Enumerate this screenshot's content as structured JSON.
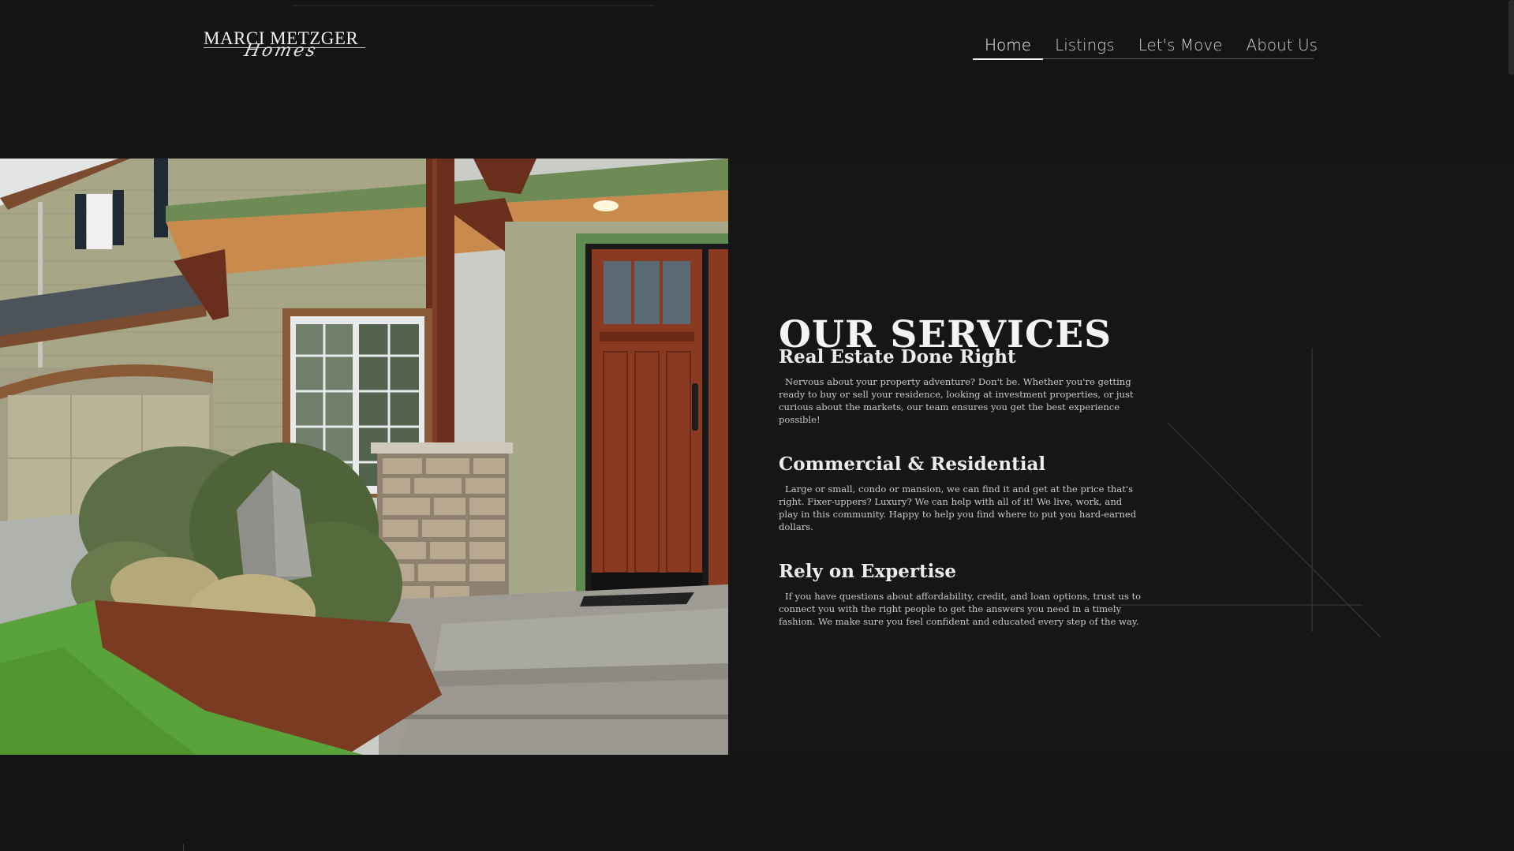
{
  "header": {
    "logo_main": "MARCI METZGER",
    "logo_script": "Homes",
    "nav": [
      {
        "label": "Home",
        "active": true
      },
      {
        "label": "Listings",
        "active": false
      },
      {
        "label": "Let's Move",
        "active": false
      },
      {
        "label": "About Us",
        "active": false
      }
    ]
  },
  "services": {
    "title": "OUR SERVICES",
    "items": [
      {
        "heading": "Real Estate Done Right",
        "body": "Nervous about your property adventure? Don't be. Whether you're getting ready to buy or sell your residence, looking at investment properties, or just curious about the markets, our team ensures you get the best experience possible!"
      },
      {
        "heading": "Commercial & Residential",
        "body": "Large or small, condo or mansion, we can find it and get at the price that's right. Fixer-uppers? Luxury? We can help with all of it! We live, work, and play in this community. Happy to help you find where to put you hard-earned dollars."
      },
      {
        "heading": "Rely on Expertise",
        "body": "If you have questions about affordability, credit, and loan options, trust us to connect you with the right people to get the answers you need in a timely fashion. We make sure you feel confident and educated every step of the way."
      }
    ]
  },
  "colors": {
    "background": "#141414",
    "text": "#ececec",
    "door": "#8b3a22",
    "siding": "#a8a98a"
  }
}
